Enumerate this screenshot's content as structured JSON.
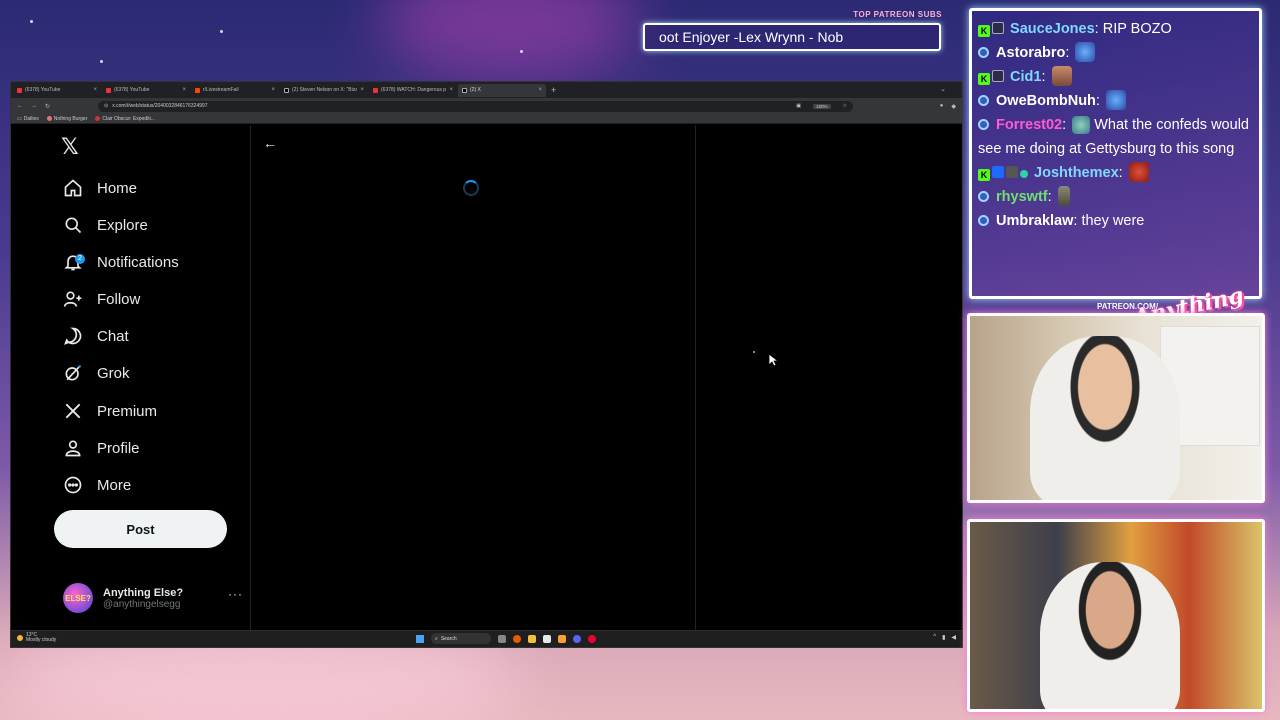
{
  "overlay": {
    "top_patreon_label": "TOP PATREON SUBS",
    "ticker_text": "oot Enjoyer -Lex Wrynn -  Nob"
  },
  "browser": {
    "tabs": [
      {
        "title": "(6378) YouTube",
        "active": false
      },
      {
        "title": "(6378) YouTube",
        "active": false
      },
      {
        "title": "r/LivestreamFail",
        "active": false
      },
      {
        "title": "(2) Steven Nelson on X: \"Bizarre",
        "active": false
      },
      {
        "title": "(6378) WATCH: Dangerous poi",
        "active": false
      },
      {
        "title": "(2) X",
        "active": true
      }
    ],
    "url": "x.com/i/web/status/2040032846176324997",
    "zoom": "150%",
    "bookmarks": [
      "Dailies",
      "Nothing Burger",
      "Clair Obscur: Expediti..."
    ]
  },
  "x_sidebar": {
    "nav": [
      {
        "label": "Home",
        "icon": "home-icon"
      },
      {
        "label": "Explore",
        "icon": "search-icon"
      },
      {
        "label": "Notifications",
        "icon": "bell-icon"
      },
      {
        "label": "Follow",
        "icon": "follow-icon"
      },
      {
        "label": "Chat",
        "icon": "chat-icon"
      },
      {
        "label": "Grok",
        "icon": "grok-icon"
      },
      {
        "label": "Premium",
        "icon": "x-icon"
      },
      {
        "label": "Profile",
        "icon": "person-icon"
      },
      {
        "label": "More",
        "icon": "more-circle-icon"
      }
    ],
    "notifications_badge": "2",
    "post_label": "Post",
    "account": {
      "name": "Anything Else?",
      "handle": "@anythingelsegg",
      "avatar_text": "ELSE?"
    }
  },
  "taskbar": {
    "temperature": "13°C",
    "weather": "Mostly cloudy",
    "search_label": "Search"
  },
  "chat": {
    "messages": [
      {
        "user": "SauceJones",
        "text": "RIP BOZO",
        "color": "#7fd8ff"
      },
      {
        "user": "Astorabro",
        "text": "",
        "color": "#ffffff"
      },
      {
        "user": "Cid1",
        "text": "",
        "color": "#7fd8ff"
      },
      {
        "user": "OweBombNuh",
        "text": "",
        "color": "#ffffff"
      },
      {
        "user": "Forrest02",
        "text": "What the confeds would see me doing at Gettysburg to this song",
        "color": "#ff5ad1"
      },
      {
        "user": "Joshthemex",
        "text": "",
        "color": "#7fd8ff"
      },
      {
        "user": "rhyswtf",
        "text": "",
        "color": "#6ee06e"
      },
      {
        "user": "Umbraklaw",
        "text": "they were",
        "color": "#ffffff"
      }
    ]
  },
  "stream": {
    "patreon_url": "PATREON.COM/",
    "logo_text": "Anything Else?"
  },
  "colors": {
    "x_blue": "#1d9bf0",
    "chat_border": "#ffffff",
    "cam_glow": "#ff7ad9"
  }
}
